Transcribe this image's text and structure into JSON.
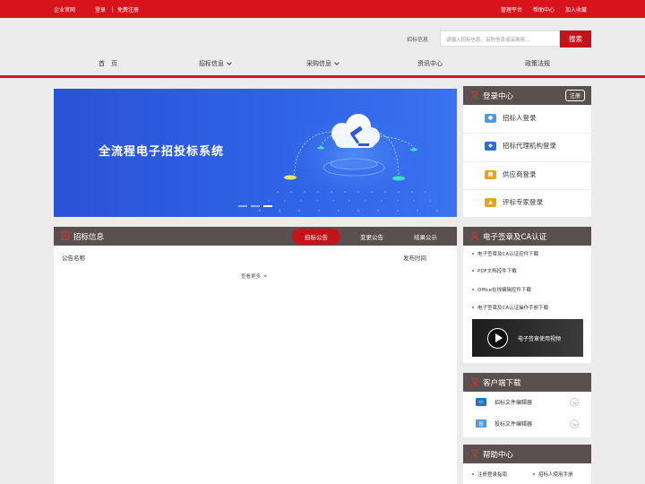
{
  "topbar": {
    "site_link": "企业官网",
    "login": "登录",
    "register": "免费注册",
    "manage": "管理平台",
    "help": "帮助中心",
    "favorite": "加入收藏"
  },
  "search": {
    "label": "招标信息",
    "placeholder": "请输入招标信息、采购信息或采购商...",
    "button": "搜索"
  },
  "nav": {
    "home": "首　页",
    "bidding": "招标信息",
    "procurement": "采购信息",
    "news": "资讯中心",
    "policy": "政策法规"
  },
  "colors": {
    "brand_red": "#d8131c",
    "panel_header": "#5a5050",
    "banner_blue": "#2f62e6"
  },
  "banner": {
    "title": "全流程电子招投标系统",
    "slides_total": 3,
    "slide_active": 3
  },
  "login_center": {
    "title": "登录中心",
    "register_btn": "注册",
    "items": [
      {
        "label": "招标人登录",
        "icon": "person-icon",
        "color": "#4a9ae8"
      },
      {
        "label": "招标代理机构登录",
        "icon": "agency-icon",
        "color": "#2f6fd8"
      },
      {
        "label": "供应商登录",
        "icon": "supplier-icon",
        "color": "#f0a020"
      },
      {
        "label": "评标专家登录",
        "icon": "expert-icon",
        "color": "#f0a020"
      }
    ]
  },
  "bid_info": {
    "title": "招标信息",
    "tabs": [
      "招标公告",
      "变更公告",
      "结果公示"
    ],
    "active_tab": 0,
    "col_name": "公告名称",
    "col_time": "发布时间",
    "more": "查看更多"
  },
  "esign": {
    "title": "电子签章及CA认证",
    "items": [
      "电子签章及CA认证控件下载",
      "PDF文档控件下载",
      "Office在线编辑控件下载",
      "电子签章及CA认证操作手册下载"
    ],
    "video_label": "电子签章使用视频"
  },
  "client_download": {
    "title": "客户端下载",
    "items": [
      {
        "label": "招标文件编辑器",
        "icon": "monitor-icon",
        "color": "#1f76c9"
      },
      {
        "label": "投标文件编辑器",
        "icon": "doc-edit-icon",
        "color": "#4a9ae8",
        "glyph": "投"
      }
    ]
  },
  "help_center": {
    "title": "帮助中心",
    "items": [
      "注册登录指南",
      "招标人使用手册"
    ]
  }
}
